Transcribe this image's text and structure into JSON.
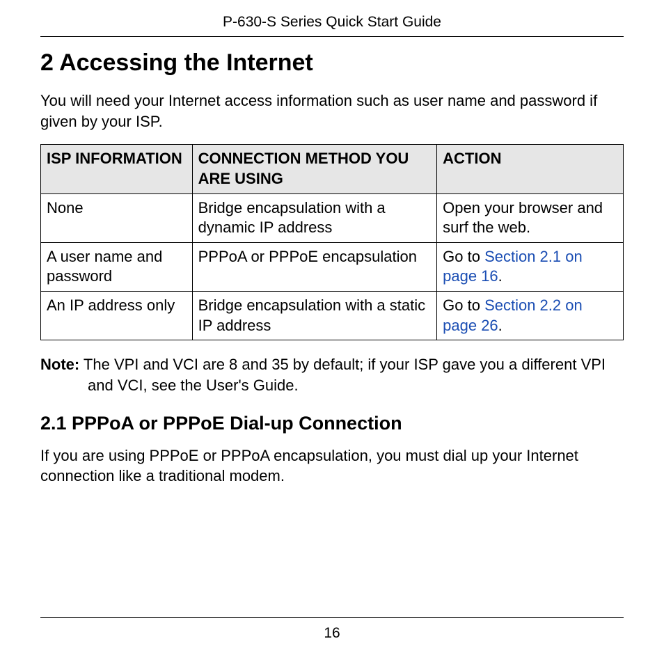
{
  "header": {
    "title": "P-630-S Series Quick Start Guide"
  },
  "section": {
    "heading": "2 Accessing the Internet",
    "intro": "You will need your Internet access information such as user name and password if given by your ISP."
  },
  "table": {
    "headers": {
      "col1": "ISP INFORMATION",
      "col2": "CONNECTION METHOD YOU ARE USING",
      "col3": "ACTION"
    },
    "rows": [
      {
        "col1": "None",
        "col2": "Bridge encapsulation with a dynamic IP address",
        "col3_text": "Open your browser and surf the web."
      },
      {
        "col1": "A user name and password",
        "col2": "PPPoA or PPPoE encapsulation",
        "col3_prefix": "Go to ",
        "col3_link": "Section 2.1 on page 16",
        "col3_suffix": "."
      },
      {
        "col1": "An IP address only",
        "col2": "Bridge encapsulation with a static IP address",
        "col3_prefix": "Go to ",
        "col3_link": "Section 2.2 on page 26",
        "col3_suffix": "."
      }
    ]
  },
  "note": {
    "label": "Note:",
    "text": " The VPI and VCI are 8 and 35 by default; if your ISP gave you a different VPI and VCI, see the User's Guide."
  },
  "subsection": {
    "heading": "2.1 PPPoA or PPPoE Dial-up Connection",
    "paragraph": "If you are using PPPoE or PPPoA encapsulation, you must dial up your Internet connection like a traditional modem."
  },
  "footer": {
    "page": "16"
  }
}
